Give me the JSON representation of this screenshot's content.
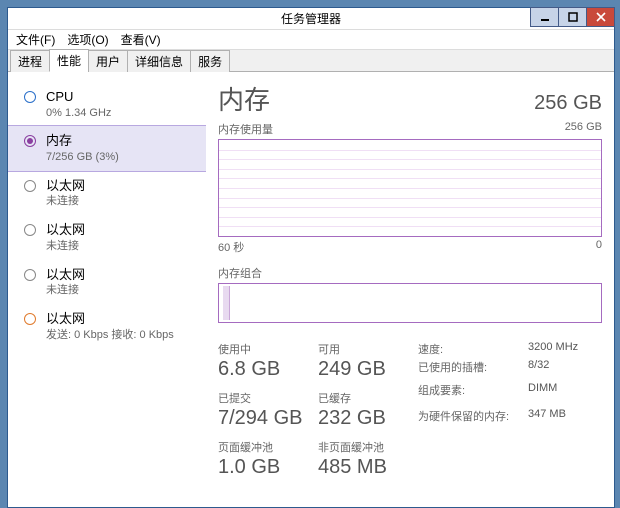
{
  "window": {
    "title": "任务管理器"
  },
  "menu": {
    "file": "文件(F)",
    "options": "选项(O)",
    "view": "查看(V)"
  },
  "tabs": {
    "processes": "进程",
    "performance": "性能",
    "users": "用户",
    "details": "详细信息",
    "services": "服务"
  },
  "sidebar": {
    "cpu": {
      "title": "CPU",
      "sub": "0% 1.34 GHz"
    },
    "mem": {
      "title": "内存",
      "sub": "7/256 GB (3%)"
    },
    "eth1": {
      "title": "以太网",
      "sub": "未连接"
    },
    "eth2": {
      "title": "以太网",
      "sub": "未连接"
    },
    "eth3": {
      "title": "以太网",
      "sub": "未连接"
    },
    "eth4": {
      "title": "以太网",
      "sub": "发送: 0 Kbps 接收: 0 Kbps"
    }
  },
  "main": {
    "title": "内存",
    "total": "256 GB",
    "usage_label": "内存使用量",
    "usage_max": "256 GB",
    "x_left": "60 秒",
    "x_right": "0",
    "comp_label": "内存组合",
    "stats": {
      "in_use_label": "使用中",
      "in_use": "6.8 GB",
      "avail_label": "可用",
      "avail": "249 GB",
      "committed_label": "已提交",
      "committed": "7/294 GB",
      "cached_label": "已缓存",
      "cached": "232 GB",
      "paged_label": "页面缓冲池",
      "paged": "1.0 GB",
      "nonpaged_label": "非页面缓冲池",
      "nonpaged": "485 MB"
    },
    "kv": {
      "speed_label": "速度:",
      "speed": "3200 MHz",
      "slots_label": "已使用的插槽:",
      "slots": "8/32",
      "form_label": "组成要素:",
      "form": "DIMM",
      "hw_reserved_label": "为硬件保留的内存:",
      "hw_reserved": "347 MB"
    }
  },
  "chart_data": {
    "type": "line",
    "title": "内存使用量",
    "xlabel": "秒",
    "ylabel": "GB",
    "xlim": [
      0,
      60
    ],
    "ylim": [
      0,
      256
    ],
    "series": [
      {
        "name": "内存使用量",
        "x": [
          60,
          0
        ],
        "values": [
          7,
          7
        ]
      }
    ]
  }
}
